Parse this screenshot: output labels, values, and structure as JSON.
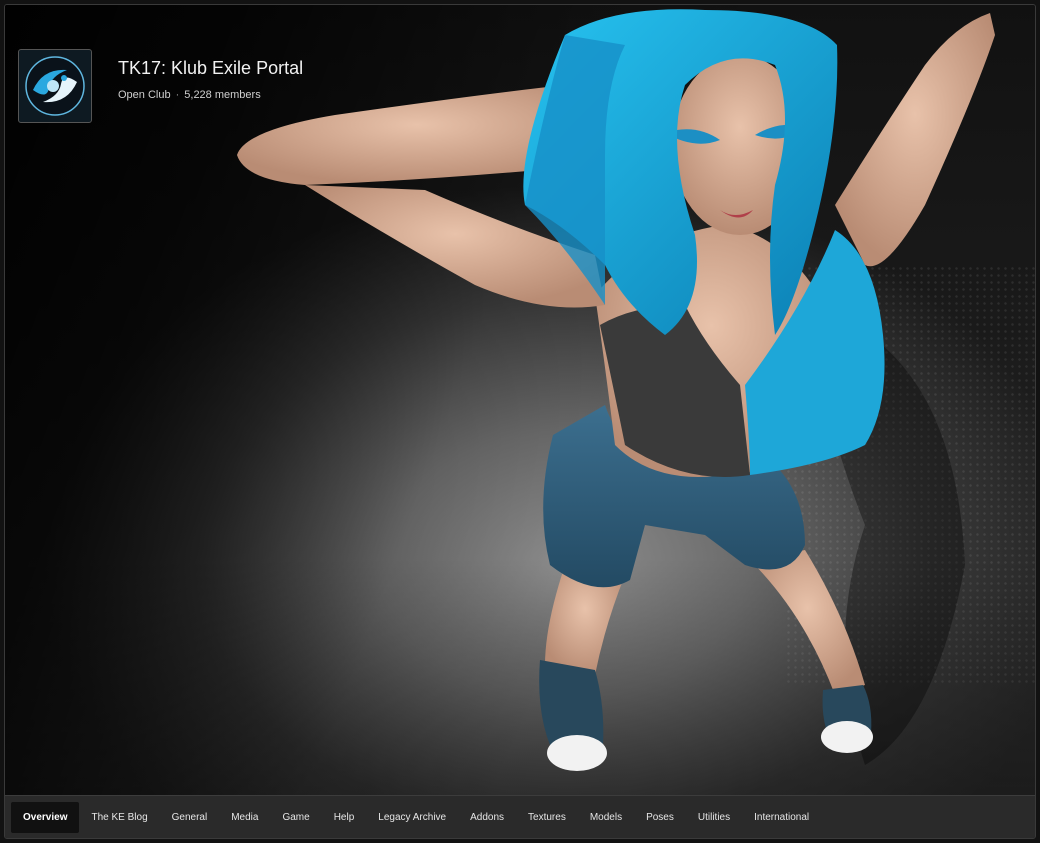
{
  "club": {
    "title": "TK17: Klub Exile Portal",
    "type": "Open Club",
    "separator": "·",
    "members": "5,228 members",
    "logo_icon": "club-logo-swirl-icon"
  },
  "nav": {
    "tabs": [
      {
        "label": "Overview",
        "active": true
      },
      {
        "label": "The KE Blog"
      },
      {
        "label": "General"
      },
      {
        "label": "Media"
      },
      {
        "label": "Game"
      },
      {
        "label": "Help"
      },
      {
        "label": "Legacy Archive"
      },
      {
        "label": "Addons"
      },
      {
        "label": "Textures"
      },
      {
        "label": "Models"
      },
      {
        "label": "Poses"
      },
      {
        "label": "Utilities"
      },
      {
        "label": "International"
      }
    ]
  },
  "colors": {
    "accent": "#1fa9dc",
    "nav_bg": "#2a2a2a",
    "active_tab_bg": "#111111"
  }
}
